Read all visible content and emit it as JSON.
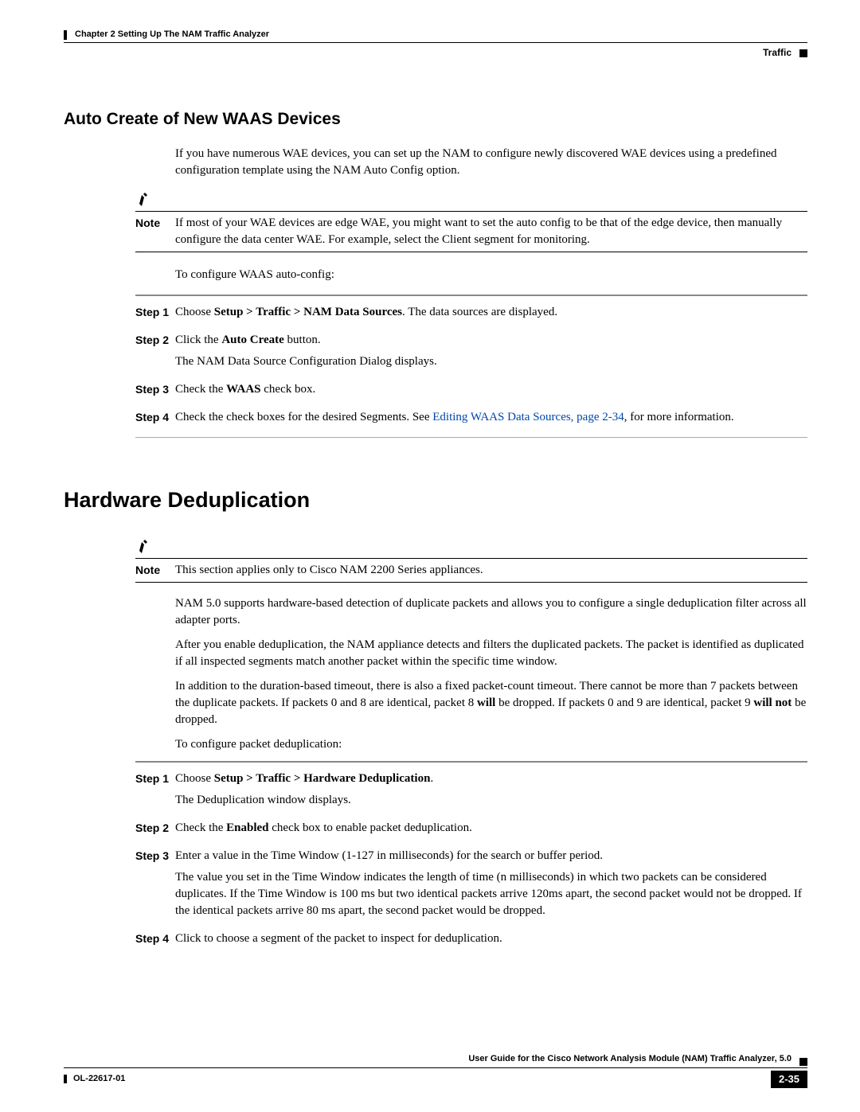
{
  "header": {
    "chapter": "Chapter 2      Setting Up The NAM Traffic Analyzer",
    "section": "Traffic"
  },
  "s1": {
    "title": "Auto Create of New WAAS Devices",
    "intro": "If you have numerous WAE devices, you can set up the NAM to configure newly discovered WAE devices using a predefined configuration template using the NAM Auto Config option.",
    "note_label": "Note",
    "note_text": "If most of your WAE devices are edge WAE, you might want to set the auto config to be that of the edge device, then manually configure the data center WAE. For example, select the Client segment for monitoring.",
    "leadin": "To configure WAAS auto-config:",
    "steps": [
      {
        "label": "Step 1",
        "pre": "Choose ",
        "b": "Setup > Traffic > NAM Data Sources",
        "post": ". The data sources are displayed."
      },
      {
        "label": "Step 2",
        "pre": "Click the ",
        "b": "Auto Create",
        "post": " button.",
        "extra": "The NAM Data Source Configuration Dialog displays."
      },
      {
        "label": "Step 3",
        "pre": "Check the ",
        "b": "WAAS",
        "post": " check box."
      },
      {
        "label": "Step 4",
        "pre": "Check the check boxes for the desired Segments. See ",
        "link": "Editing WAAS Data Sources, page 2-34",
        "post": ", for more information."
      }
    ]
  },
  "s2": {
    "title": "Hardware Deduplication",
    "note_label": "Note",
    "note_text": "This section applies only to Cisco NAM 2200 Series appliances.",
    "p1": "NAM 5.0 supports hardware-based detection of duplicate packets and allows you to configure a single deduplication filter across all adapter ports.",
    "p2": "After you enable deduplication, the NAM appliance detects and filters the duplicated packets. The packet is identified as duplicated if all inspected segments match another packet within the specific time window.",
    "p3_a": "In addition to the duration-based timeout, there is also a fixed packet-count timeout. There cannot be more than 7 packets between the duplicate packets. If packets 0 and 8 are identical, packet 8 ",
    "p3_b1": "will",
    "p3_c": " be dropped. If packets 0 and 9 are identical, packet 9 ",
    "p3_b2": "will not",
    "p3_d": " be dropped.",
    "leadin": "To configure packet deduplication:",
    "steps": {
      "s1": {
        "label": "Step 1",
        "pre": "Choose ",
        "b": "Setup > Traffic > Hardware Deduplication",
        "post": ".",
        "extra": "The Deduplication window displays."
      },
      "s2": {
        "label": "Step 2",
        "pre": "Check the ",
        "b": "Enabled",
        "post": " check box to enable packet deduplication."
      },
      "s3": {
        "label": "Step 3",
        "text": "Enter a value in the Time Window (1-127 in milliseconds) for the search or buffer period.",
        "extra": "The value you set in the Time Window indicates the length of time (n milliseconds) in which two packets can be considered duplicates. If the Time Window is 100 ms but two identical packets arrive 120ms apart, the second packet would not be dropped. If the identical packets arrive 80 ms apart, the second packet would be dropped."
      },
      "s4": {
        "label": "Step 4",
        "text": "Click to choose a segment of the packet to inspect for deduplication."
      }
    }
  },
  "footer": {
    "title": "User Guide for the Cisco Network Analysis Module (NAM) Traffic Analyzer, 5.0",
    "doc_id": "OL-22617-01",
    "page": "2-35"
  }
}
